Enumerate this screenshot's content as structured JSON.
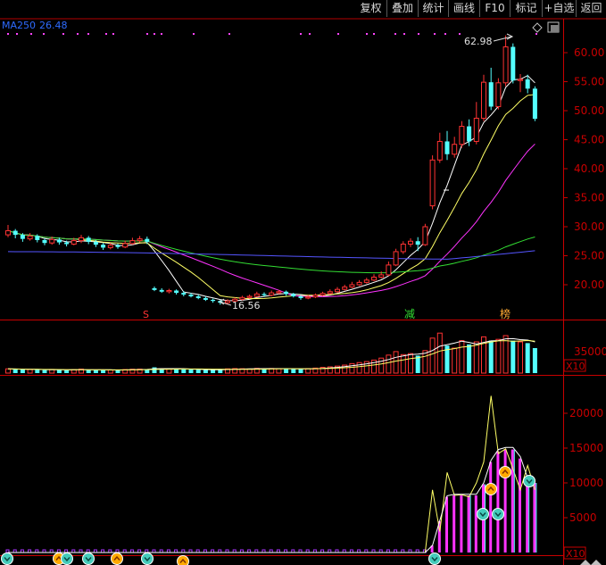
{
  "toolbar": {
    "buttons": [
      "复权",
      "叠加",
      "统计",
      "画线",
      "F10",
      "标记",
      "+自选",
      "返回"
    ]
  },
  "indicator_label": "MA250",
  "indicator_value": "26.48",
  "price_axis": {
    "labels": [
      "60.00",
      "55.00",
      "50.00",
      "45.00",
      "40.00",
      "35.00",
      "30.00",
      "25.00",
      "20.00"
    ],
    "values": [
      60,
      55,
      50,
      45,
      40,
      35,
      30,
      25,
      20
    ]
  },
  "volume_axis": {
    "label": "35000",
    "multiplier": "X10"
  },
  "indicator_axis": {
    "labels": [
      "20000",
      "15000",
      "10000",
      "5000"
    ],
    "values": [
      20000,
      15000,
      10000,
      5000
    ],
    "multiplier": "X10"
  },
  "annotations": {
    "high": "62.98",
    "low": "16.56"
  },
  "markers": {
    "s": "S",
    "jian": "减",
    "bang": "榜"
  },
  "colors": {
    "up": "#ff3333",
    "down": "#54ffff",
    "ma_white": "#ffffff",
    "ma_yellow": "#ffff66",
    "ma_magenta": "#ff33ff",
    "ma_green": "#33dd33",
    "ma_blue": "#5555ff",
    "axis_red": "#c80000",
    "bg": "#000000"
  },
  "icons": {
    "diamond": "diamond-icon",
    "layers": "layers-icon",
    "arrow_up_circle": "arrow-up-circle-icon",
    "arrow_down_circle": "arrow-down-circle-icon"
  },
  "chart_data": {
    "type": "candlestick",
    "ylim": [
      15,
      64
    ],
    "candles": [
      [
        28.6,
        29.3,
        30.3,
        28.2
      ],
      [
        29.3,
        28.6,
        29.6,
        28.0
      ],
      [
        28.6,
        27.9,
        28.9,
        27.4
      ],
      [
        27.9,
        28.4,
        28.9,
        27.6
      ],
      [
        28.4,
        27.7,
        28.7,
        27.3
      ],
      [
        27.7,
        27.2,
        28.0,
        26.8
      ],
      [
        27.2,
        27.8,
        28.3,
        26.9
      ],
      [
        27.8,
        27.3,
        28.1,
        26.9
      ],
      [
        27.3,
        27.0,
        27.6,
        26.6
      ],
      [
        27.0,
        27.6,
        28.1,
        26.8
      ],
      [
        27.6,
        28.1,
        28.6,
        27.2
      ],
      [
        28.1,
        27.4,
        28.4,
        27.0
      ],
      [
        27.4,
        26.9,
        27.7,
        26.5
      ],
      [
        26.9,
        26.4,
        27.2,
        26.0
      ],
      [
        26.4,
        26.8,
        27.2,
        26.1
      ],
      [
        26.8,
        26.5,
        27.1,
        26.2
      ],
      [
        26.5,
        27.1,
        27.6,
        26.3
      ],
      [
        27.1,
        27.6,
        28.1,
        26.9
      ],
      [
        27.6,
        27.9,
        28.4,
        27.3
      ],
      [
        27.9,
        27.4,
        28.3,
        27.0
      ],
      [
        19.4,
        19.1,
        19.7,
        18.9
      ],
      [
        19.1,
        18.8,
        19.4,
        18.6
      ],
      [
        18.8,
        19.0,
        19.3,
        18.5
      ],
      [
        19.0,
        18.6,
        19.2,
        18.3
      ],
      [
        18.6,
        18.3,
        18.9,
        18.0
      ],
      [
        18.3,
        18.0,
        18.6,
        17.8
      ],
      [
        18.0,
        17.7,
        18.3,
        17.5
      ],
      [
        17.7,
        17.4,
        18.0,
        17.2
      ],
      [
        17.4,
        17.2,
        17.6,
        16.9
      ],
      [
        17.2,
        16.9,
        17.4,
        16.56
      ],
      [
        16.9,
        17.2,
        17.5,
        16.7
      ],
      [
        17.2,
        17.5,
        17.8,
        17.0
      ],
      [
        17.5,
        17.8,
        18.1,
        17.3
      ],
      [
        17.8,
        18.0,
        18.3,
        17.6
      ],
      [
        18.0,
        18.4,
        18.8,
        17.8
      ],
      [
        18.4,
        18.2,
        18.7,
        17.9
      ],
      [
        18.2,
        18.6,
        19.0,
        18.0
      ],
      [
        18.6,
        18.8,
        19.1,
        18.4
      ],
      [
        18.8,
        18.4,
        19.0,
        18.1
      ],
      [
        18.4,
        18.0,
        18.6,
        17.8
      ],
      [
        18.0,
        17.7,
        18.2,
        17.4
      ],
      [
        17.7,
        17.9,
        18.2,
        17.5
      ],
      [
        17.9,
        18.2,
        18.5,
        17.7
      ],
      [
        18.2,
        18.5,
        18.8,
        18.0
      ],
      [
        18.5,
        18.8,
        19.2,
        18.3
      ],
      [
        18.8,
        19.2,
        19.6,
        18.6
      ],
      [
        19.2,
        19.6,
        20.0,
        19.0
      ],
      [
        19.6,
        20.0,
        20.5,
        19.4
      ],
      [
        20.0,
        20.4,
        20.8,
        19.8
      ],
      [
        20.4,
        20.8,
        21.2,
        20.2
      ],
      [
        20.8,
        21.3,
        21.8,
        20.6
      ],
      [
        21.3,
        21.7,
        22.3,
        21.1
      ],
      [
        21.7,
        23.4,
        24.0,
        21.5
      ],
      [
        23.4,
        25.7,
        26.2,
        23.2
      ],
      [
        25.7,
        27.0,
        27.5,
        25.3
      ],
      [
        27.0,
        27.5,
        28.0,
        26.5
      ],
      [
        27.5,
        26.9,
        28.2,
        25.8
      ],
      [
        26.9,
        30.0,
        30.5,
        26.7
      ],
      [
        33.6,
        41.5,
        42.3,
        33.0
      ],
      [
        41.5,
        44.7,
        46.2,
        41.0
      ],
      [
        44.7,
        42.5,
        46.5,
        41.5
      ],
      [
        42.5,
        44.2,
        45.5,
        41.9
      ],
      [
        44.2,
        47.3,
        48.2,
        43.6
      ],
      [
        47.3,
        44.7,
        48.5,
        43.9
      ],
      [
        44.7,
        48.7,
        51.5,
        44.2
      ],
      [
        48.7,
        54.9,
        56.2,
        48.2
      ],
      [
        54.9,
        50.7,
        57.4,
        50.1
      ],
      [
        50.7,
        54.8,
        55.6,
        50.2
      ],
      [
        54.8,
        61.0,
        62.98,
        54.2
      ],
      [
        61.0,
        55.2,
        61.6,
        54.7
      ],
      [
        55.2,
        55.4,
        56.3,
        53.2
      ],
      [
        55.4,
        53.8,
        56.2,
        53.0
      ],
      [
        53.8,
        48.6,
        54.2,
        48.2
      ]
    ],
    "volume": [
      170,
      160,
      140,
      150,
      130,
      120,
      145,
      130,
      110,
      140,
      160,
      135,
      120,
      115,
      125,
      120,
      140,
      155,
      160,
      150,
      230,
      190,
      170,
      160,
      150,
      140,
      135,
      130,
      125,
      150,
      170,
      180,
      175,
      165,
      190,
      175,
      185,
      180,
      170,
      160,
      160,
      180,
      200,
      230,
      250,
      280,
      320,
      380,
      420,
      460,
      520,
      600,
      720,
      860,
      740,
      780,
      700,
      900,
      1400,
      1600,
      1100,
      1000,
      1300,
      1150,
      1250,
      1450,
      1300,
      1350,
      1500,
      1300,
      1250,
      1200,
      1000
    ],
    "indicator": [
      0,
      0,
      0,
      0,
      0,
      0,
      0,
      0,
      0,
      0,
      0,
      0,
      0,
      0,
      0,
      0,
      0,
      0,
      0,
      0,
      0,
      0,
      0,
      0,
      0,
      0,
      0,
      0,
      0,
      0,
      0,
      0,
      0,
      0,
      0,
      0,
      0,
      0,
      0,
      0,
      0,
      0,
      0,
      0,
      0,
      0,
      0,
      0,
      0,
      0,
      0,
      0,
      0,
      0,
      0,
      0,
      0,
      0,
      1000,
      4500,
      8000,
      8200,
      8200,
      8200,
      8200,
      9800,
      13000,
      14500,
      14800,
      14800,
      13500,
      10500,
      10000
    ]
  }
}
